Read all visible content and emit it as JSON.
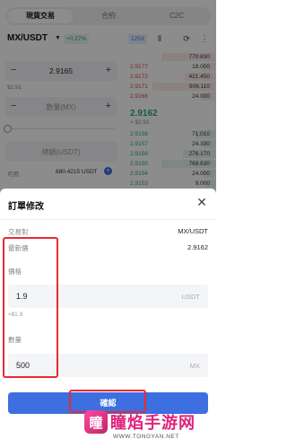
{
  "tabs": [
    "現貨交易",
    "合約",
    "C2C"
  ],
  "pair": {
    "name": "MX/USDT",
    "change": "+0.27%",
    "leverage": "125X"
  },
  "form": {
    "price": "2.9165",
    "price_sub": "$2.91",
    "qty_placeholder": "數量(MX)",
    "total_placeholder": "總額(USDT)",
    "avail_label": "可用",
    "avail_value": "680.4215 USDT"
  },
  "orderbook": {
    "asks": [
      {
        "price": "",
        "qty": "770.830"
      },
      {
        "price": "2.9177",
        "qty": "18.000"
      },
      {
        "price": "2.9172",
        "qty": "421.450"
      },
      {
        "price": "2.9171",
        "qty": "906.110"
      },
      {
        "price": "2.9168",
        "qty": "24.000"
      }
    ],
    "mid": "2.9162",
    "mid_sub": "≈ $2.91",
    "bids": [
      {
        "price": "2.9158",
        "qty": "71.010"
      },
      {
        "price": "2.9157",
        "qty": "24.330"
      },
      {
        "price": "2.9156",
        "qty": "276.170"
      },
      {
        "price": "2.9155",
        "qty": "769.630"
      },
      {
        "price": "2.9154",
        "qty": "24.000"
      },
      {
        "price": "2.9153",
        "qty": "9.000"
      }
    ]
  },
  "sheet": {
    "title": "訂單修改",
    "pair_label": "交易對",
    "pair_value": "MX/USDT",
    "last_label": "最新價",
    "last_value": "2.9162",
    "price_label": "價格",
    "price_value": "1.9",
    "price_unit": "USDT",
    "price_hint": "≈$1.9",
    "qty_label": "數量",
    "qty_value": "500",
    "qty_unit": "MX",
    "confirm_label": "確認"
  },
  "highlight_color": "#e62b33",
  "watermark": {
    "text": "瞳焰手游网",
    "url": "WWW.TONGYAN.NET"
  }
}
